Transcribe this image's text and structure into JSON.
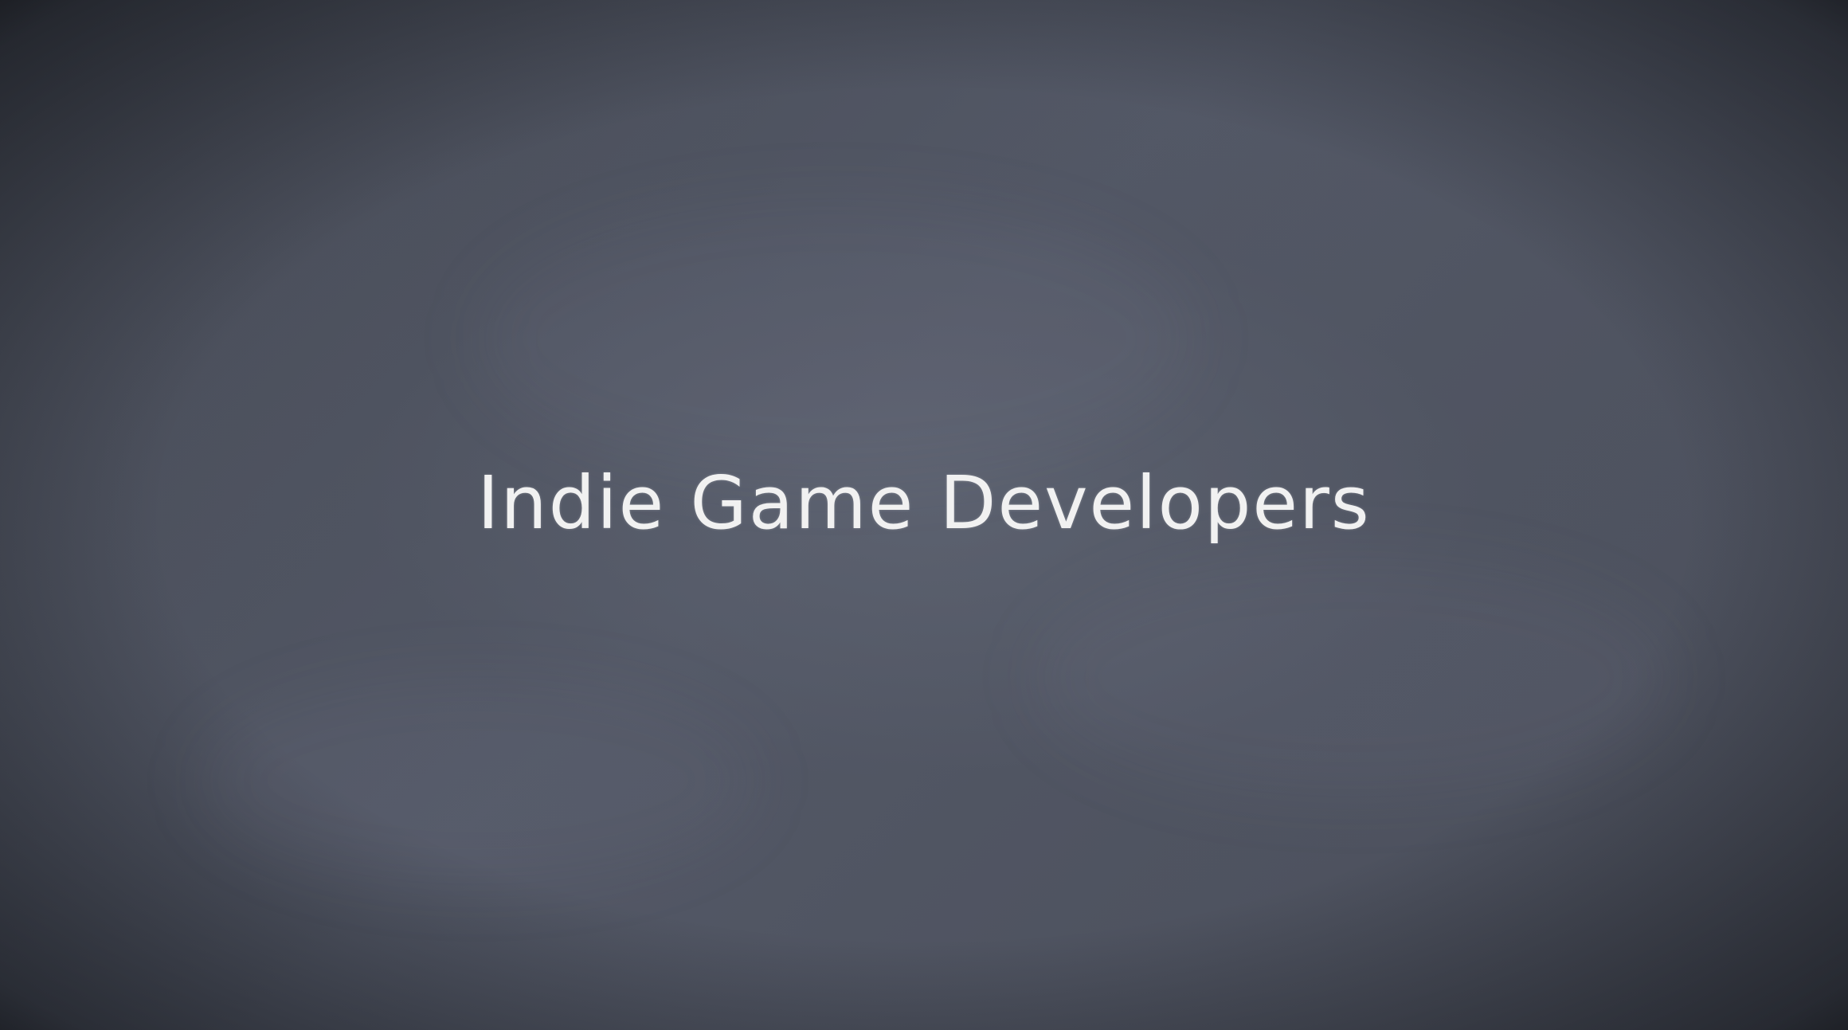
{
  "slide": {
    "title": "Indie Game Developers"
  }
}
